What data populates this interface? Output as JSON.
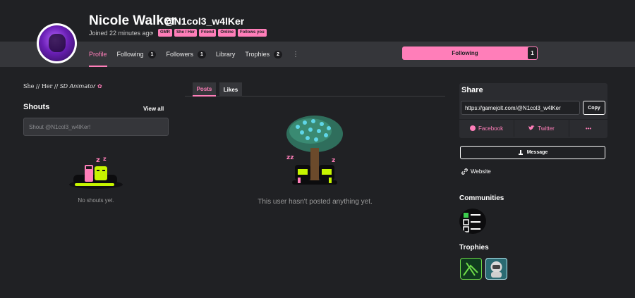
{
  "profile": {
    "name": "Nicole Walker",
    "handle": "@N1col3_w4lKer",
    "joined": "Joined 22 minutes ago",
    "dot": "•",
    "tags": [
      "GMR",
      "She / Her",
      "Friend",
      "Online",
      "Follows you"
    ]
  },
  "nav": {
    "tabs": [
      {
        "label": "Profile",
        "count": null,
        "active": true
      },
      {
        "label": "Following",
        "count": "1"
      },
      {
        "label": "Followers",
        "count": "1"
      },
      {
        "label": "Library",
        "count": null
      },
      {
        "label": "Trophies",
        "count": "2"
      }
    ],
    "more": "⋮",
    "follow_label": "Following",
    "follow_count": "1"
  },
  "left": {
    "bio": "She // Her // 𝘚𝘋 𝘈𝘯𝘪𝘮𝘢𝘵𝘰𝘳",
    "bio_flower": "✿",
    "shouts_title": "Shouts",
    "view_all": "View all",
    "shout_placeholder": "Shout @N1col3_w4lKer!",
    "empty": "No shouts yet."
  },
  "center": {
    "tab_posts": "Posts",
    "tab_likes": "Likes",
    "empty": "This user hasn't posted anything yet."
  },
  "right": {
    "share_title": "Share",
    "share_url": "https://gamejolt.com/@N1col3_w4lKer",
    "copy": "Copy",
    "facebook": "Facebook",
    "twitter": "Twitter",
    "more": "•••",
    "message": "Message",
    "website": "Website",
    "communities_title": "Communities",
    "trophies_title": "Trophies"
  },
  "colors": {
    "accent": "#ff7eb9",
    "background": "#202124",
    "nav_band": "#35363a"
  },
  "icons": [
    "avatar",
    "facebook-icon",
    "twitter-icon",
    "message-icon",
    "link-icon",
    "more-icon",
    "community-icon",
    "trophy-icon"
  ]
}
